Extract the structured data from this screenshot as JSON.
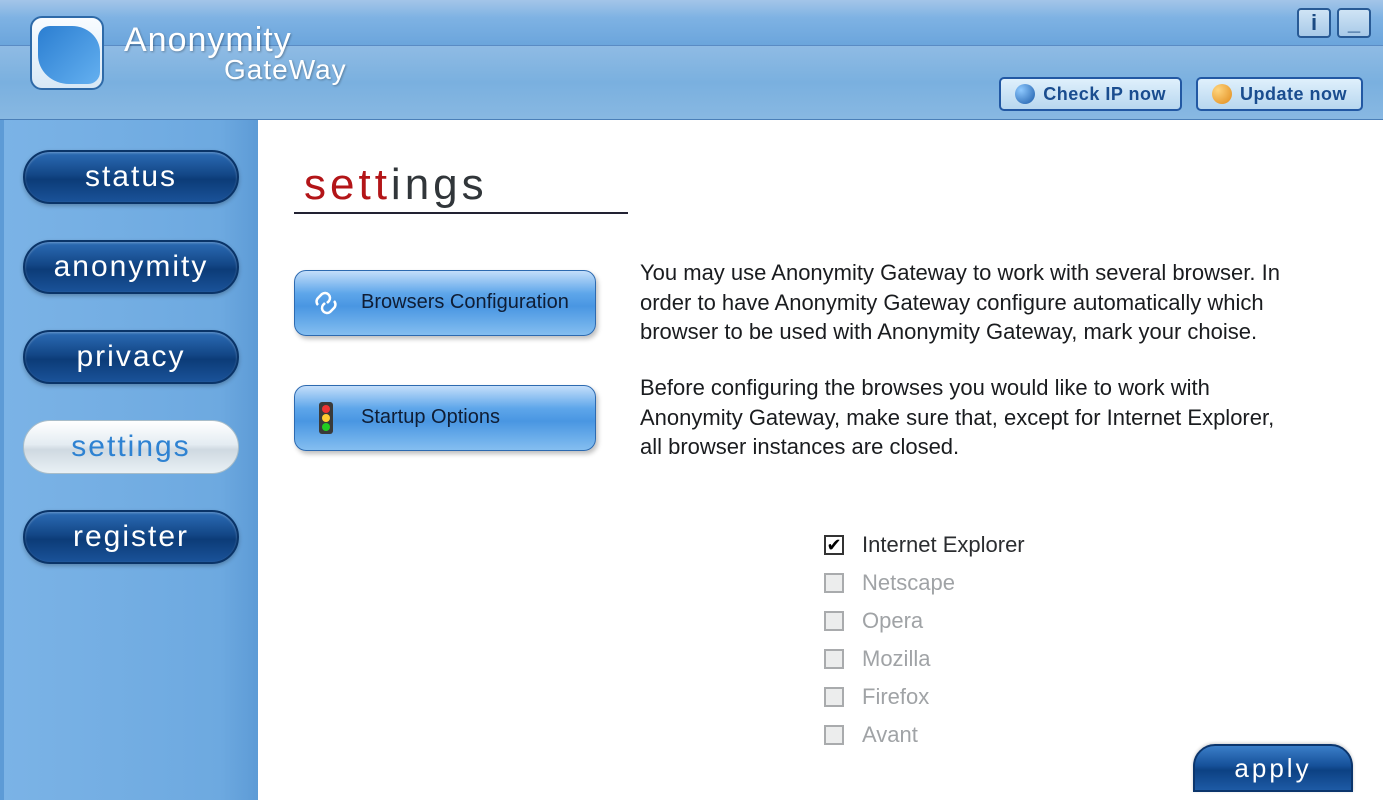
{
  "app": {
    "title_line1": "Anonymity",
    "title_line2": "GateWay"
  },
  "titlebar": {
    "info_label": "i",
    "minimize_label": "_"
  },
  "header": {
    "check_ip": "Check IP now",
    "update": "Update now"
  },
  "sidebar": {
    "items": [
      {
        "label": "status"
      },
      {
        "label": "anonymity"
      },
      {
        "label": "privacy"
      },
      {
        "label": "settings"
      },
      {
        "label": "register"
      }
    ]
  },
  "page": {
    "title_accent": "sett",
    "title_rest": "ings",
    "browsers_config_label": "Browsers Configuration",
    "startup_options_label": "Startup Options",
    "desc1": "You may use Anonymity Gateway to work with several browser. In order to have Anonymity Gateway configure automatically which browser to be used with Anonymity Gateway, mark your choise.",
    "desc2": "Before configuring the browses you would like to work with Anonymity Gateway, make sure that, except for Internet Explorer, all browser instances are closed.",
    "browsers": [
      {
        "label": "Internet Explorer",
        "checked": true,
        "enabled": true
      },
      {
        "label": "Netscape",
        "checked": false,
        "enabled": false
      },
      {
        "label": "Opera",
        "checked": false,
        "enabled": false
      },
      {
        "label": "Mozilla",
        "checked": false,
        "enabled": false
      },
      {
        "label": "Firefox",
        "checked": false,
        "enabled": false
      },
      {
        "label": "Avant",
        "checked": false,
        "enabled": false
      }
    ],
    "apply_label": "apply"
  }
}
